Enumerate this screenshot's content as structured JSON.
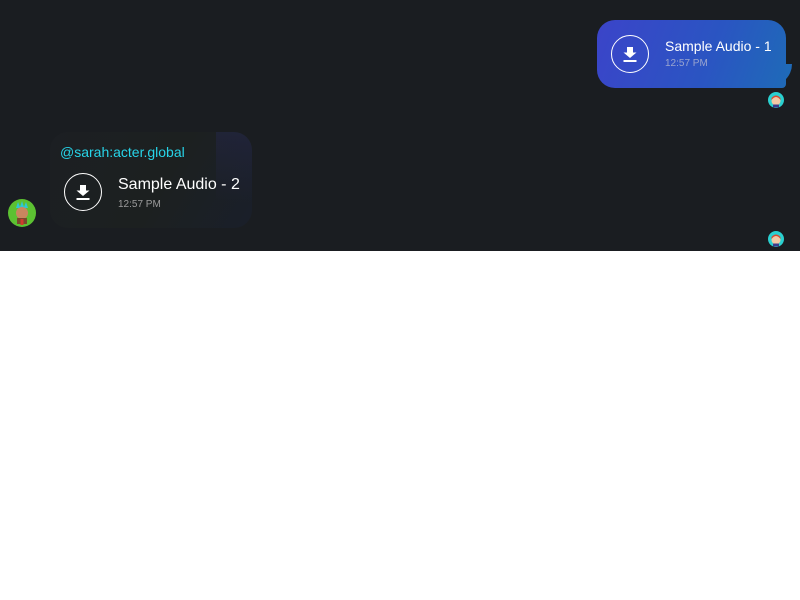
{
  "messages": [
    {
      "direction": "outgoing",
      "title": "Sample Audio - 1",
      "time": "12:57 PM",
      "icon": "download-icon"
    },
    {
      "direction": "incoming",
      "sender": "@sarah:acter.global",
      "title": "Sample Audio - 2",
      "time": "12:57 PM",
      "icon": "download-icon"
    }
  ],
  "colors": {
    "background": "#1a1d21",
    "outgoing_bubble": "#3b44c9",
    "sender_name": "#27d4e8",
    "text": "#ffffff"
  }
}
